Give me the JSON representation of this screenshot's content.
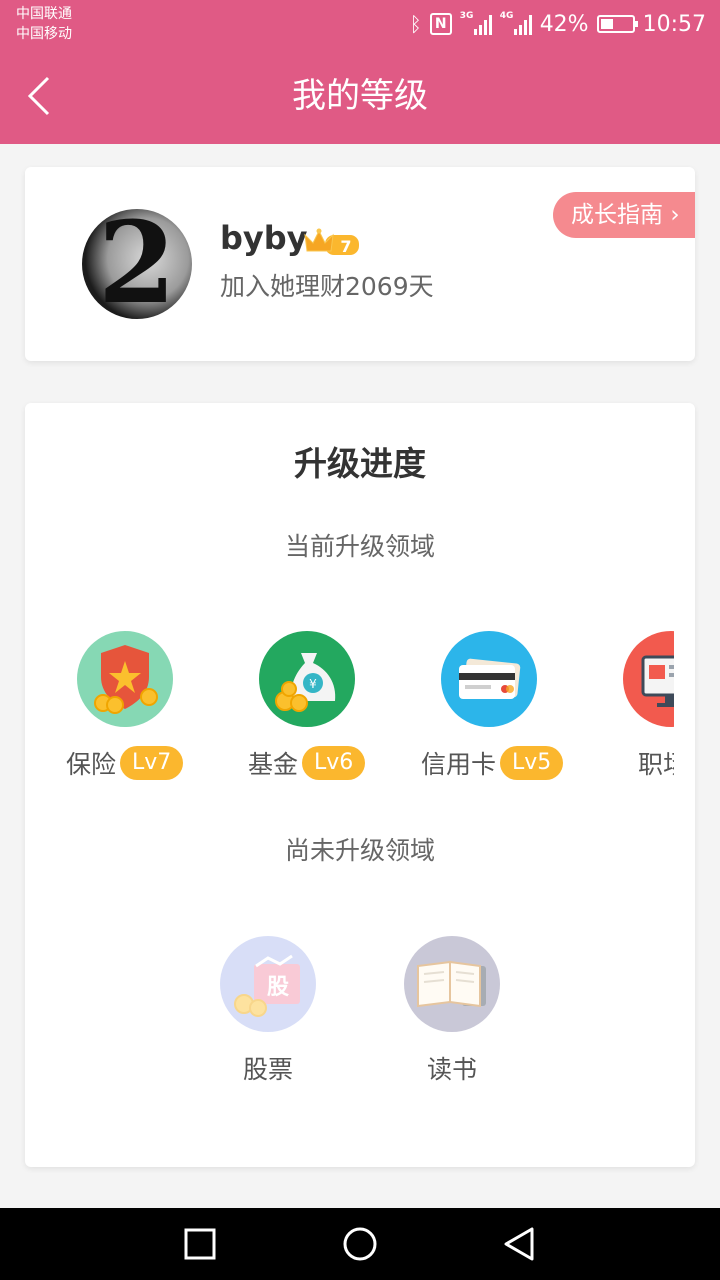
{
  "status_bar": {
    "carrier_1": "中国联通",
    "carrier_2": "中国移动",
    "net_1": "3G",
    "net_2": "4G",
    "battery": "42%",
    "battery_level": 0.42,
    "time": "10:57"
  },
  "header": {
    "title": "我的等级"
  },
  "profile": {
    "avatar_digit": "2",
    "username": "byby",
    "level_badge": "7",
    "joined_text": "加入她理财2069天",
    "guide_button": "成长指南"
  },
  "progress": {
    "title": "升级进度",
    "current_label": "当前升级领域",
    "current": [
      {
        "name": "保险",
        "level": "Lv7",
        "icon": "insurance-shield-icon"
      },
      {
        "name": "基金",
        "level": "Lv6",
        "icon": "fund-money-bag-icon"
      },
      {
        "name": "信用卡",
        "level": "Lv5",
        "icon": "credit-card-icon"
      },
      {
        "name": "职场",
        "level": "",
        "icon": "workplace-monitor-icon"
      }
    ],
    "pending_label": "尚未升级领域",
    "pending": [
      {
        "name": "股票",
        "icon_text": "股",
        "icon": "stock-icon"
      },
      {
        "name": "读书",
        "icon": "book-icon"
      }
    ]
  },
  "colors": {
    "primary": "#e05a85",
    "badge": "#fbb72e",
    "guide": "#f58a8f"
  }
}
